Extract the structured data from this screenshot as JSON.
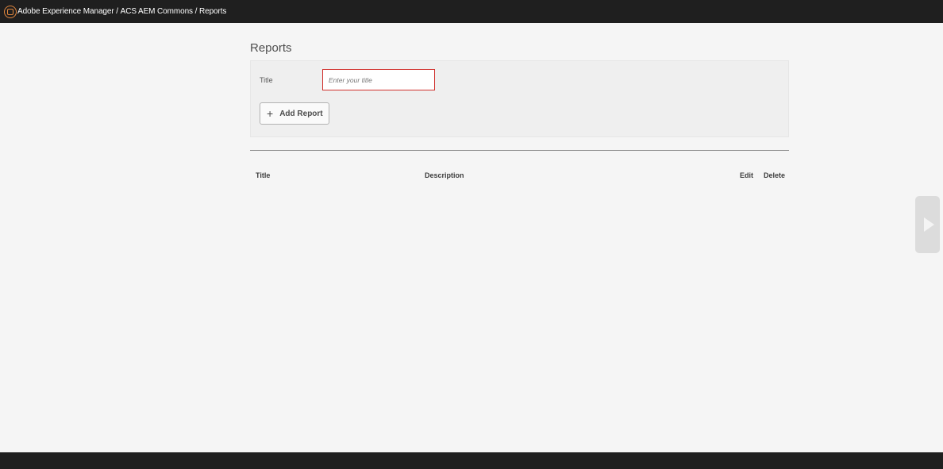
{
  "header": {
    "logo_icon": "adobe-experience-manager-logo",
    "breadcrumb": [
      "Adobe Experience Manager",
      "ACS AEM Commons",
      "Reports"
    ],
    "separator": " / "
  },
  "page": {
    "title": "Reports"
  },
  "form": {
    "title_label": "Title",
    "title_input": {
      "value": "",
      "placeholder": "Enter your title"
    },
    "add_button_label": "Add Report",
    "add_button_icon": "plus-icon"
  },
  "table": {
    "columns": [
      "Title",
      "Description",
      "Edit",
      "Delete"
    ],
    "rows": []
  },
  "side_panel": {
    "toggle_icon": "play-arrow-icon"
  },
  "colors": {
    "topbar": "#1f1f1f",
    "accent_logo": "#e2873e",
    "input_error_border": "#d0312d",
    "background": "#f5f5f5"
  }
}
